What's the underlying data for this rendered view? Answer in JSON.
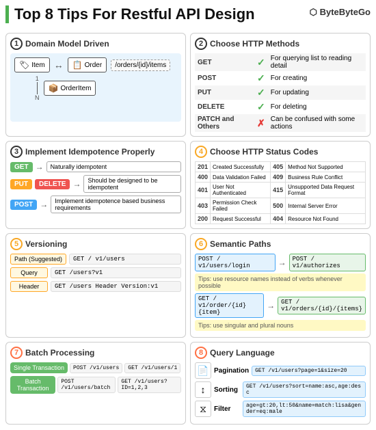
{
  "header": {
    "title": "Top 8 Tips For Restful API Design",
    "brand": "⬡ ByteByteGo"
  },
  "cards": [
    {
      "num": "1",
      "title": "Domain Model Driven",
      "entities": [
        "Item",
        "Order",
        "OrderItem"
      ],
      "path_example": "/orders/{id}/items",
      "multiplicity": [
        "1",
        "N"
      ]
    },
    {
      "num": "2",
      "title": "Choose HTTP Methods",
      "methods": [
        {
          "name": "GET",
          "icon": "✓",
          "icon_type": "green",
          "desc": "For querying list to reading detail"
        },
        {
          "name": "POST",
          "icon": "✓",
          "icon_type": "green",
          "desc": "For creating"
        },
        {
          "name": "PUT",
          "icon": "✓",
          "icon_type": "green",
          "desc": "For updating"
        },
        {
          "name": "DELETE",
          "icon": "✓",
          "icon_type": "green",
          "desc": "For deleting"
        },
        {
          "name": "PATCH and Others",
          "icon": "✗",
          "icon_type": "red",
          "desc": "Can be confused with some actions"
        }
      ]
    },
    {
      "num": "3",
      "title": "Implement Idempotence Properly",
      "rows": [
        {
          "methods": [
            "GET"
          ],
          "label": "Naturally idempotent"
        },
        {
          "methods": [
            "PUT",
            "DELETE"
          ],
          "label": "Should be designed to be idempotent"
        },
        {
          "methods": [
            "POST"
          ],
          "label": "Implement idempotence based business requirements"
        }
      ]
    },
    {
      "num": "4",
      "title": "Choose HTTP Status Codes",
      "codes": [
        {
          "code": "201",
          "desc": "Created Successfully"
        },
        {
          "code": "405",
          "desc": "Method Not Supported"
        },
        {
          "code": "400",
          "desc": "Data Validation Failed"
        },
        {
          "code": "409",
          "desc": "Business Rule Conflict"
        },
        {
          "code": "401",
          "desc": "User Not Authenticated"
        },
        {
          "code": "415",
          "desc": "Unsupported Data Request Format"
        },
        {
          "code": "403",
          "desc": "Permission Check Failed"
        },
        {
          "code": "500",
          "desc": "Internal Server Error"
        },
        {
          "code": "200",
          "desc": "Request Successful"
        },
        {
          "code": "404",
          "desc": "Resource Not Found"
        }
      ]
    },
    {
      "num": "5",
      "title": "Versioning",
      "rows": [
        {
          "tag": "Path (Suggested)",
          "code": "GET / v1/users"
        },
        {
          "tag": "Query",
          "code": "GET /users?v1"
        },
        {
          "tag": "Header",
          "code": "GET /users  Header Version:v1"
        }
      ]
    },
    {
      "num": "6",
      "title": "Semantic Paths",
      "rows": [
        {
          "from": "POST / v1/users/login",
          "to": "POST / v1/authorizes"
        },
        {
          "tip": "Tips: use resource names instead of verbs whenever possible"
        },
        {
          "from": "GET / v1/order/{id}{item}",
          "to": "GET / v1/orders/{id}/{items}"
        },
        {
          "tip": "Tips: use singular and plural nouns"
        }
      ]
    },
    {
      "num": "7",
      "title": "Batch Processing",
      "rows": [
        {
          "tag": "Single Transaction",
          "actions": [
            "POST /v1/users",
            "GET /v1/users/1"
          ]
        },
        {
          "tag": "Batch Transaction",
          "actions": [
            "POST /v1/users/batch",
            "GET /v1/users?ID=1,2,3"
          ]
        }
      ]
    },
    {
      "num": "8",
      "title": "Query Language",
      "rows": [
        {
          "icon": "📄",
          "label": "Pagination",
          "code": "GET /v1/users?page=1&size=20"
        },
        {
          "icon": "↕",
          "label": "Sorting",
          "code": "GET /v1/users?sort=name:asc,age:desc"
        },
        {
          "icon": "⧖",
          "label": "Filter",
          "code": "age=gt:20,lt:50&name=match:lisa&gender=eq:male"
        }
      ]
    }
  ]
}
